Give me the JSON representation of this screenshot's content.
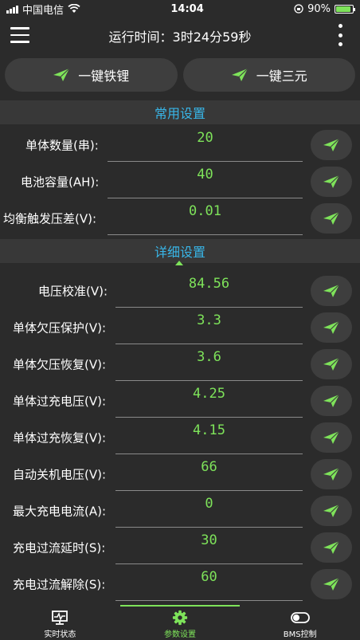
{
  "status_bar": {
    "carrier": "中国电信",
    "time": "14:04",
    "battery": "90%",
    "battery_level": 0.9
  },
  "header": {
    "runtime": "运行时间：3时24分59秒"
  },
  "presets": [
    {
      "label": "一键铁锂"
    },
    {
      "label": "一键三元"
    }
  ],
  "common_section": {
    "title": "常用设置",
    "rows": [
      {
        "label": "单体数量(串):",
        "value": "20"
      },
      {
        "label": "电池容量(AH):",
        "value": "40"
      },
      {
        "label": "均衡触发压差(V):",
        "value": "0.01"
      }
    ]
  },
  "detail_section": {
    "title": "详细设置",
    "rows": [
      {
        "label": "电压校准(V):",
        "value": "84.56"
      },
      {
        "label": "单体欠压保护(V):",
        "value": "3.3"
      },
      {
        "label": "单体欠压恢复(V):",
        "value": "3.6"
      },
      {
        "label": "单体过充电压(V):",
        "value": "4.25"
      },
      {
        "label": "单体过充恢复(V):",
        "value": "4.15"
      },
      {
        "label": "自动关机电压(V):",
        "value": "66"
      },
      {
        "label": "最大充电电流(A):",
        "value": "0"
      },
      {
        "label": "充电过流延时(S):",
        "value": "30"
      },
      {
        "label": "充电过流解除(S):",
        "value": "60"
      }
    ]
  },
  "tabs": [
    {
      "label": "实时状态",
      "icon": "monitor-icon"
    },
    {
      "label": "参数设置",
      "icon": "gear-icon"
    },
    {
      "label": "BMS控制",
      "icon": "toggle-icon"
    }
  ],
  "colors": {
    "accent": "#7ee35a",
    "section_title": "#38b6e8",
    "background": "#2b2b2b"
  }
}
